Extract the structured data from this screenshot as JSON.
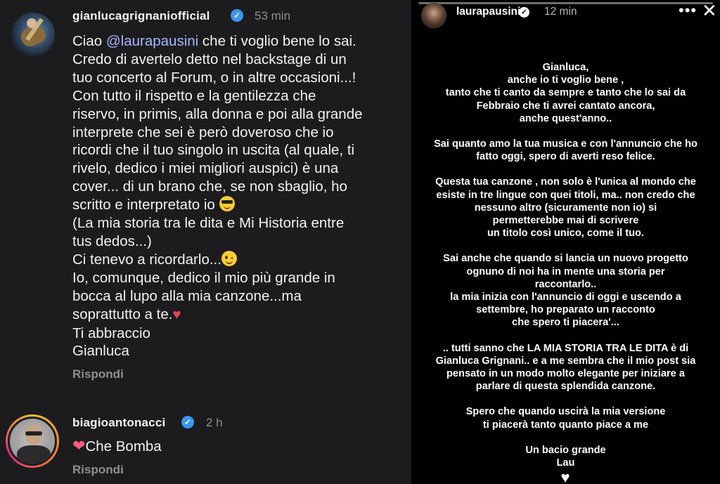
{
  "left_panel": {
    "comment1": {
      "username": "gianlucagrignaniofficial",
      "time": "53 min",
      "text_lines": [
        "Ciao ",
        "@laurapausini",
        " che ti voglio bene lo sai.\nCredo di avertelo detto nel backstage di un\ntuo concerto al Forum, o in altre occasioni...!\nCon tutto il rispetto e la gentilezza che\nriservo, in primis, alla donna  e poi alla grande\ninterprete che sei è però doveroso che io\nricordi che il tuo singolo in uscita (al quale, ti\nrivelo, dedico i miei migliori auspici) è una\ncover... di un brano che, se non sbaglio, ho\nscritto e interpretato io ",
        "\n(La mia storia tra le dita e Mi Historia entre\ntus dedos...)\nCi tenevo a ricordarlo...",
        "\nIo, comunque, dedico il mio più grande  in\nbocca al lupo alla mia canzone...ma\nsoprattutto a te.",
        "\nTi abbraccio\nGianluca"
      ],
      "reply": "Rispondi",
      "emojis": [
        "sunglasses-face",
        "winking-face",
        "anatomical-heart"
      ]
    },
    "comment2": {
      "username": "biagioantonacci",
      "time": "2 h",
      "heart": "❤",
      "text": "Che Bomba",
      "reply": "Rispondi"
    }
  },
  "right_panel": {
    "username": "laurapausini",
    "time": "12 min",
    "more": "•••",
    "close": "✕",
    "paragraphs": [
      [
        "Gianluca,",
        "anche io ti voglio bene ,",
        "tanto che ti canto da sempre e tanto che lo sai da",
        "Febbraio che ti avrei cantato ancora,",
        "anche quest'anno.."
      ],
      [
        "Sai quanto amo la tua musica e con l'annuncio che ho",
        "fatto oggi, spero  di averti reso felice."
      ],
      [
        "Questa tua canzone ,  non solo è l'unica al mondo che",
        "esiste in tre lingue con quei titoli, ma.. non credo che",
        "nessuno altro (sicuramente non io) si",
        "permetterebbe mai di scrivere",
        "un titolo così unico, come il tuo."
      ],
      [
        "Sai anche che quando si lancia un nuovo progetto",
        "ognuno di noi ha in mente una storia per",
        "raccontarlo..",
        "la mia inizia con l'annuncio di oggi e uscendo a",
        "settembre, ho preparato un racconto",
        "che spero ti piacera'..."
      ],
      [
        ".. tutti sanno che LA MIA STORIA TRA LE DITA è di",
        "Gianluca Grignani.. e a me sembra che il mio post sia",
        "pensato in un modo molto elegante per iniziare a",
        "parlare di questa splendida canzone."
      ],
      [
        "Spero  che quando uscirà la mia versione",
        "ti piacerà tanto quanto  piace a me"
      ],
      [
        "Un bacio grande",
        "Lau"
      ]
    ],
    "closing_heart": "♥"
  }
}
